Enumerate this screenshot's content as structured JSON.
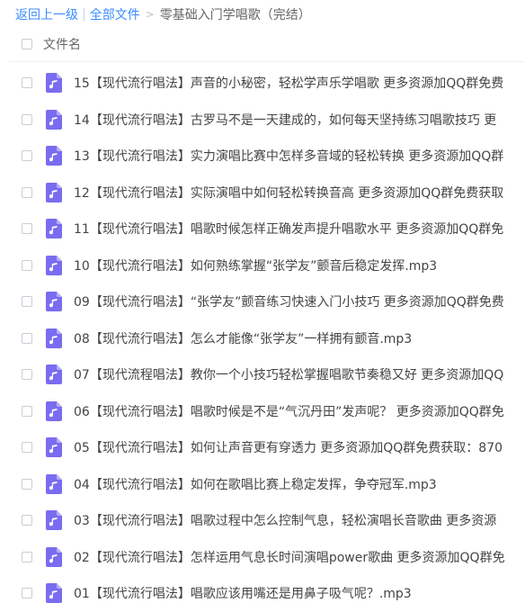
{
  "breadcrumb": {
    "back": "返回上一级",
    "all_files": "全部文件",
    "current": "零基础入门学唱歌（完结）"
  },
  "header": {
    "column_name": "文件名"
  },
  "colors": {
    "link": "#3b8cff",
    "icon": "#7a6cf0",
    "text": "#444444"
  },
  "files": [
    {
      "name": "15【现代流行唱法】声音的小秘密，轻松学声乐学唱歌 更多资源加QQ群免费",
      "icon": "audio-file-icon"
    },
    {
      "name": "14【现代流行唱法】古罗马不是一天建成的，如何每天坚持练习唱歌技巧 更",
      "icon": "audio-file-icon"
    },
    {
      "name": "13【现代流行唱法】实力演唱比赛中怎样多音域的轻松转换 更多资源加QQ群",
      "icon": "audio-file-icon"
    },
    {
      "name": "12【现代流行唱法】实际演唱中如何轻松转换音高 更多资源加QQ群免费获取",
      "icon": "audio-file-icon"
    },
    {
      "name": "11【现代流行唱法】唱歌时候怎样正确发声提升唱歌水平 更多资源加QQ群免",
      "icon": "audio-file-icon"
    },
    {
      "name": "10【现代流行唱法】如何熟练掌握“张学友”颤音后稳定发挥.mp3",
      "icon": "audio-file-icon"
    },
    {
      "name": "09【现代流行唱法】“张学友”颤音练习快速入门小技巧 更多资源加QQ群免费",
      "icon": "audio-file-icon"
    },
    {
      "name": "08【现代流行唱法】怎么才能像“张学友”一样拥有颤音.mp3",
      "icon": "audio-file-icon"
    },
    {
      "name": "07【现代流程唱法】教你一个小技巧轻松掌握唱歌节奏稳又好 更多资源加QQ",
      "icon": "audio-file-icon"
    },
    {
      "name": "06【现代流行唱法】唱歌时候是不是“气沉丹田”发声呢？ 更多资源加QQ群免",
      "icon": "audio-file-icon"
    },
    {
      "name": "05【现代流行唱法】如何让声音更有穿透力 更多资源加QQ群免费获取：870",
      "icon": "audio-file-icon"
    },
    {
      "name": "04【现代流行唱法】如何在歌唱比赛上稳定发挥，争夺冠军.mp3",
      "icon": "audio-file-icon"
    },
    {
      "name": "03【现代流行唱法】唱歌过程中怎么控制气息，轻松演唱长音歌曲 更多资源",
      "icon": "audio-file-icon"
    },
    {
      "name": "02【现代流行唱法】怎样运用气息长时间演唱power歌曲 更多资源加QQ群免",
      "icon": "audio-file-icon"
    },
    {
      "name": "01【现代流行唱法】唱歌应该用嘴还是用鼻子吸气呢？.mp3",
      "icon": "audio-file-icon"
    }
  ]
}
